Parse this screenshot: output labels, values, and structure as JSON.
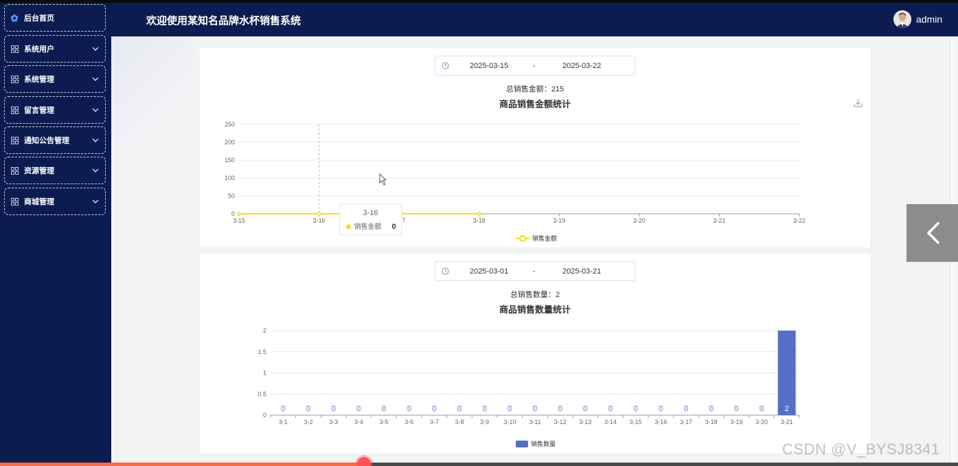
{
  "app": {
    "title": "欢迎使用某知名品牌水杯销售系统",
    "user": "admin"
  },
  "sidebar": {
    "items": [
      {
        "label": "后台首页",
        "icon": "home-icon"
      },
      {
        "label": "系统用户",
        "icon": "grid-icon"
      },
      {
        "label": "系统管理",
        "icon": "grid-icon"
      },
      {
        "label": "留言管理",
        "icon": "grid-icon"
      },
      {
        "label": "通知公告管理",
        "icon": "grid-icon"
      },
      {
        "label": "资源管理",
        "icon": "grid-icon"
      },
      {
        "label": "商城管理",
        "icon": "grid-icon"
      }
    ]
  },
  "colors": {
    "sidebar": "#0c1c50",
    "line": "#f5e20e",
    "bar": "#5470c6",
    "accent": "#ff6a3d"
  },
  "card1": {
    "start": "2025-03-15",
    "end": "2025-03-22",
    "sep": "-",
    "total_label": "总销售金额：",
    "total_value": "215"
  },
  "card2": {
    "start": "2025-03-01",
    "end": "2025-03-21",
    "sep": "-",
    "total_label": "总销售数量：",
    "total_value": "2"
  },
  "tooltip": {
    "title": "3-16",
    "label": "销售金额",
    "value": "0"
  },
  "watermark": "CSDN @V_BYSJ8341",
  "video": {
    "progress": 0.38
  },
  "chart_data": [
    {
      "type": "line",
      "title": "商品销售金额统计",
      "categories": [
        "3-15",
        "3-16",
        "3-17",
        "3-18",
        "3-19",
        "3-20",
        "3-21",
        "3-22"
      ],
      "series": [
        {
          "name": "销售金额",
          "values": [
            0,
            0,
            0,
            0,
            null,
            null,
            null,
            null
          ]
        }
      ],
      "yticks": [
        0,
        50,
        100,
        150,
        200,
        250
      ],
      "ylim": [
        0,
        250
      ],
      "grid": true,
      "legend": "bottom"
    },
    {
      "type": "bar",
      "title": "商品销售数量统计",
      "categories": [
        "3-1",
        "3-2",
        "3-3",
        "3-4",
        "3-5",
        "3-6",
        "3-7",
        "3-8",
        "3-9",
        "3-10",
        "3-11",
        "3-12",
        "3-13",
        "3-14",
        "3-15",
        "3-16",
        "3-17",
        "3-18",
        "3-19",
        "3-20",
        "3-21"
      ],
      "series": [
        {
          "name": "销售数量",
          "values": [
            0,
            0,
            0,
            0,
            0,
            0,
            0,
            0,
            0,
            0,
            0,
            0,
            0,
            0,
            0,
            0,
            0,
            0,
            0,
            0,
            2
          ]
        }
      ],
      "yticks": [
        "0",
        "0.5",
        "1",
        "1.5",
        "2"
      ],
      "ylim": [
        0,
        2
      ],
      "grid": true,
      "legend": "bottom"
    }
  ]
}
